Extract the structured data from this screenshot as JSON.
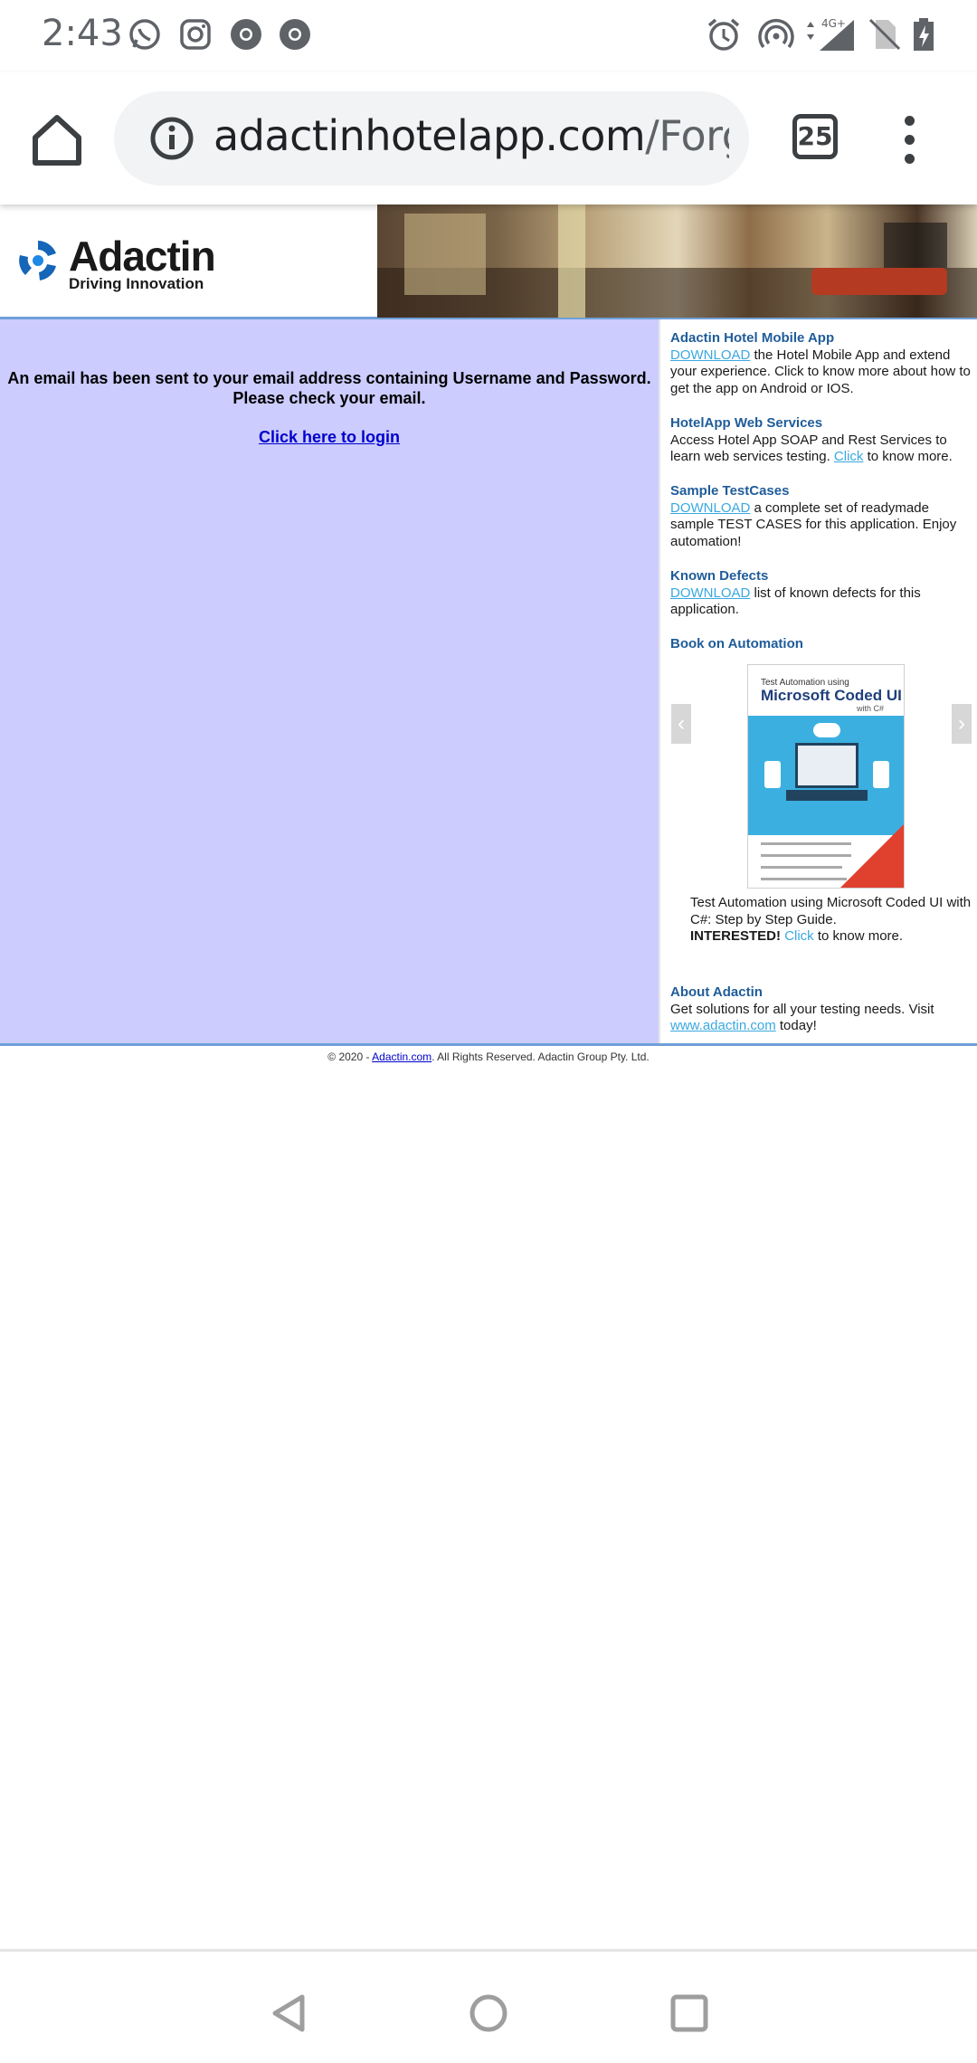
{
  "status_bar": {
    "time": "2:43",
    "network_label": "4G+",
    "icons": [
      "whatsapp-icon",
      "instagram-icon",
      "chrome-icon",
      "chrome-icon",
      "alarm-icon",
      "hotspot-icon",
      "signal-icon",
      "no-sim-icon",
      "battery-charging-icon"
    ]
  },
  "browser": {
    "url_host": "adactinhotelapp.com",
    "url_path": "/ForgotPassword",
    "tab_count": "25"
  },
  "header": {
    "logo_text": "Adactin",
    "logo_tagline": "Driving Innovation"
  },
  "main": {
    "message": "An email has been sent to your email address containing Username and Password. Please check your email.",
    "login_link": "Click here to login"
  },
  "sidebar": {
    "mobile_app": {
      "title": "Adactin Hotel Mobile App",
      "link": "DOWNLOAD",
      "text": " the Hotel Mobile App and extend your experience. Click to know more about how to get the app on Android or IOS."
    },
    "web_services": {
      "title": "HotelApp Web Services",
      "text": "Access Hotel App SOAP and Rest Services to learn web services testing. ",
      "link": "Click",
      "text_after": " to know more."
    },
    "testcases": {
      "title": "Sample TestCases",
      "link": "DOWNLOAD",
      "text": " a complete set of readymade sample TEST CASES for this application. Enjoy automation!"
    },
    "defects": {
      "title": "Known Defects",
      "link": "DOWNLOAD",
      "text": " list of known defects for this application."
    },
    "book": {
      "title": "Book on Automation",
      "cover_line1": "Test Automation using",
      "cover_line2": "Microsoft Coded UI",
      "cover_line3": "with C#",
      "caption": "Test Automation using Microsoft Coded UI with C#: Step by Step Guide.",
      "interested": "INTERESTED!",
      "link": "Click",
      "text_after": " to know more."
    },
    "about": {
      "title": "About Adactin",
      "text": "Get solutions for all your testing needs. Visit ",
      "link": "www.adactin.com",
      "text_after": " today!"
    }
  },
  "footer": {
    "prefix": "© 2020 - ",
    "link": "Adactin.com",
    "suffix": ". All Rights Reserved. Adactin Group Pty. Ltd."
  }
}
